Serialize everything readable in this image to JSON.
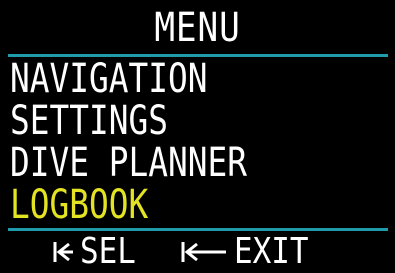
{
  "header": {
    "title": "MENU"
  },
  "menu": {
    "items": [
      {
        "label": "NAVIGATION"
      },
      {
        "label": "SETTINGS"
      },
      {
        "label": "DIVE PLANNER"
      },
      {
        "label": "LOGBOOK",
        "selected": true
      }
    ]
  },
  "footer": {
    "select": {
      "icon": "short-press-arrow-icon",
      "label": "SEL"
    },
    "exit": {
      "icon": "long-press-arrow-icon",
      "label": "EXIT"
    }
  },
  "colors": {
    "background": "#000000",
    "text": "#ffffff",
    "selected": "#e3e324",
    "divider": "#1f9bab"
  }
}
